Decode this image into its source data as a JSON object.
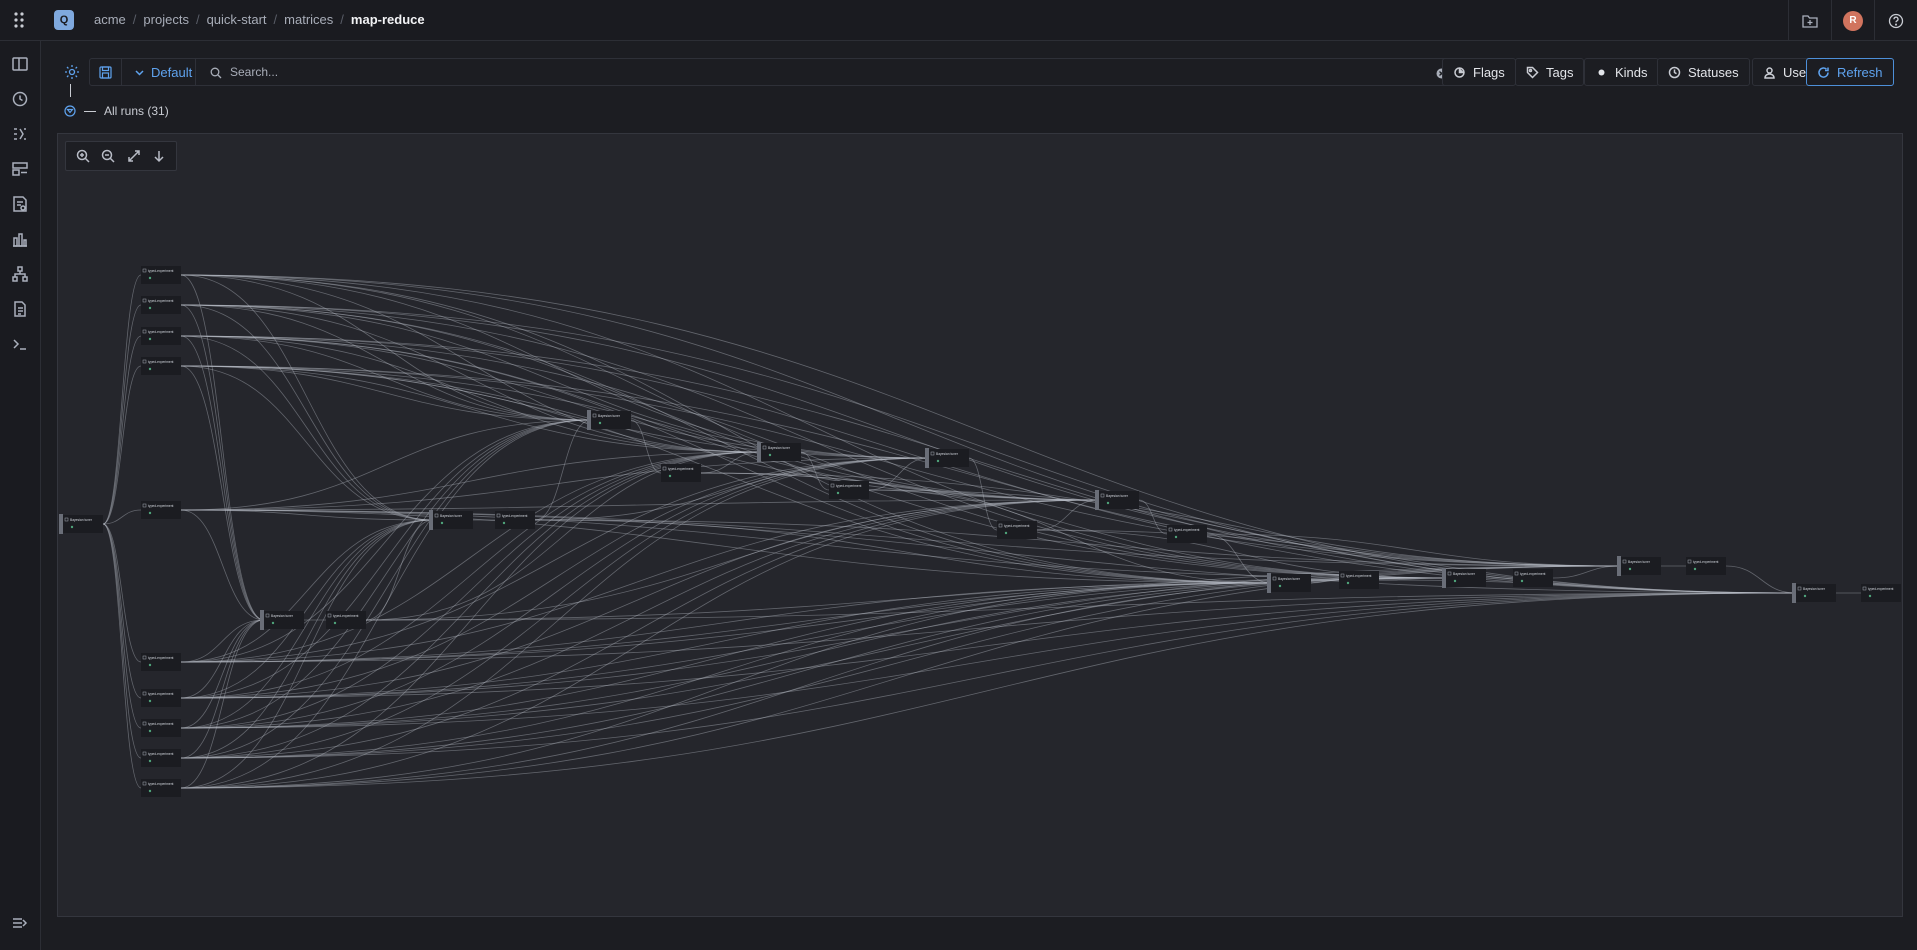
{
  "app": {
    "logo_letter": "Q"
  },
  "breadcrumb": [
    "acme",
    "projects",
    "quick-start",
    "matrices",
    "map-reduce"
  ],
  "user": {
    "avatar_letter": "R"
  },
  "toolbar": {
    "preset_label": "Default",
    "search_placeholder": "Search...",
    "filters": [
      "Flags",
      "Tags",
      "Kinds",
      "Statuses",
      "Users"
    ],
    "refresh_label": "Refresh"
  },
  "runs": {
    "label": "All runs (31)"
  },
  "graph": {
    "node_labels": {
      "tuner": "Bayesian tuner",
      "experiment": "typed-experiment"
    }
  },
  "colors": {
    "accent": "#5fa3ef",
    "background": "#1c1d22",
    "canvas": "#25262c"
  }
}
